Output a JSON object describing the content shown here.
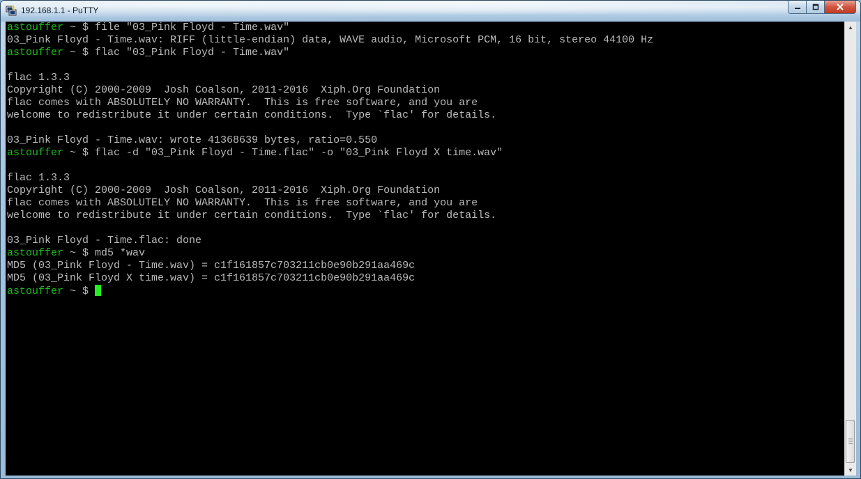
{
  "window": {
    "title": "192.168.1.1 - PuTTY",
    "app_icon": "putty-icon",
    "buttons": {
      "minimize_icon": "minimize-icon",
      "maximize_icon": "maximize-icon",
      "close_icon": "close-icon"
    }
  },
  "terminal": {
    "colors": {
      "background": "#000000",
      "text": "#bbbbbb",
      "prompt": "#18c018",
      "cursor": "#22ee22"
    },
    "lines": [
      {
        "prompt": "astouffer",
        "text": " ~ $ file \"03_Pink Floyd - Time.wav\""
      },
      {
        "prompt": "",
        "text": "03_Pink Floyd - Time.wav: RIFF (little-endian) data, WAVE audio, Microsoft PCM, 16 bit, stereo 44100 Hz"
      },
      {
        "prompt": "astouffer",
        "text": " ~ $ flac \"03_Pink Floyd - Time.wav\""
      },
      {
        "prompt": "",
        "text": ""
      },
      {
        "prompt": "",
        "text": "flac 1.3.3"
      },
      {
        "prompt": "",
        "text": "Copyright (C) 2000-2009  Josh Coalson, 2011-2016  Xiph.Org Foundation"
      },
      {
        "prompt": "",
        "text": "flac comes with ABSOLUTELY NO WARRANTY.  This is free software, and you are"
      },
      {
        "prompt": "",
        "text": "welcome to redistribute it under certain conditions.  Type `flac' for details."
      },
      {
        "prompt": "",
        "text": ""
      },
      {
        "prompt": "",
        "text": "03_Pink Floyd - Time.wav: wrote 41368639 bytes, ratio=0.550"
      },
      {
        "prompt": "astouffer",
        "text": " ~ $ flac -d \"03_Pink Floyd - Time.flac\" -o \"03_Pink Floyd X time.wav\""
      },
      {
        "prompt": "",
        "text": ""
      },
      {
        "prompt": "",
        "text": "flac 1.3.3"
      },
      {
        "prompt": "",
        "text": "Copyright (C) 2000-2009  Josh Coalson, 2011-2016  Xiph.Org Foundation"
      },
      {
        "prompt": "",
        "text": "flac comes with ABSOLUTELY NO WARRANTY.  This is free software, and you are"
      },
      {
        "prompt": "",
        "text": "welcome to redistribute it under certain conditions.  Type `flac' for details."
      },
      {
        "prompt": "",
        "text": ""
      },
      {
        "prompt": "",
        "text": "03_Pink Floyd - Time.flac: done"
      },
      {
        "prompt": "astouffer",
        "text": " ~ $ md5 *wav"
      },
      {
        "prompt": "",
        "text": "MD5 (03_Pink Floyd - Time.wav) = c1f161857c703211cb0e90b291aa469c"
      },
      {
        "prompt": "",
        "text": "MD5 (03_Pink Floyd X time.wav) = c1f161857c703211cb0e90b291aa469c"
      },
      {
        "prompt": "astouffer",
        "text": " ~ $ ",
        "cursor": true
      }
    ]
  },
  "scrollbar": {
    "up_icon": "scroll-up-arrow-icon",
    "down_icon": "scroll-down-arrow-icon"
  }
}
